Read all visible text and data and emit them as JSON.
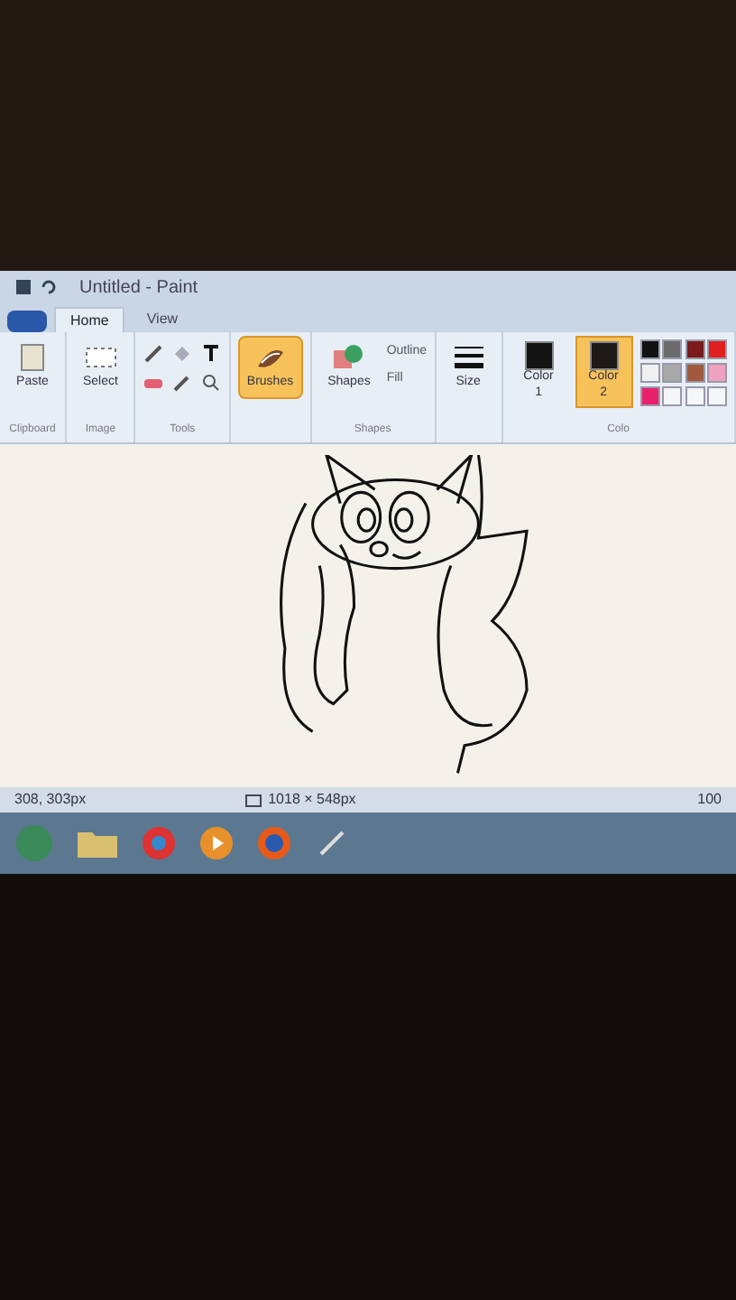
{
  "window": {
    "title": "Untitled - Paint"
  },
  "tabs": [
    {
      "label": "Home",
      "selected": true
    },
    {
      "label": "View",
      "selected": false
    }
  ],
  "ribbon": {
    "groups": [
      {
        "label": "Clipboard",
        "tools": [
          {
            "kind": "big",
            "label": "Paste",
            "selected": false
          }
        ]
      },
      {
        "label": "Image",
        "tools": [
          {
            "kind": "big",
            "label": "Select",
            "selected": false
          }
        ]
      },
      {
        "label": "Tools",
        "tools": [
          {
            "kind": "grid"
          }
        ]
      },
      {
        "tools": [
          {
            "kind": "big",
            "label": "Brushes",
            "selected": true
          }
        ]
      },
      {
        "label": "Shapes",
        "tools": [
          {
            "kind": "big",
            "label": "Shapes",
            "selected": false
          },
          {
            "kind": "options",
            "items": [
              "Outline",
              "Fill"
            ]
          }
        ]
      },
      {
        "tools": [
          {
            "kind": "big",
            "label": "Size",
            "selected": false
          }
        ]
      },
      {
        "label": "Colo",
        "tools": [
          {
            "kind": "swatch",
            "label": "Color 1",
            "color": "#141414",
            "selected": false
          },
          {
            "kind": "swatch",
            "label": "Color 2",
            "color": "#1e1a18",
            "selected": true
          },
          {
            "kind": "palette",
            "colors": [
              {
                "color": "#111111"
              },
              {
                "color": "#6b6b6b"
              },
              {
                "color": "#7a1a1a"
              },
              {
                "color": "#e02020"
              },
              {
                "color": "#f0f0f0"
              },
              {
                "color": "#a8a8a8"
              },
              {
                "color": "#a05a40"
              },
              {
                "color": "#f0a0c0"
              },
              {
                "color": "#e8206a"
              }
            ]
          }
        ]
      }
    ]
  },
  "status_bar": {
    "cursor": "308, 303px",
    "canvas_size": "1018 × 548px",
    "zoom": "100"
  }
}
